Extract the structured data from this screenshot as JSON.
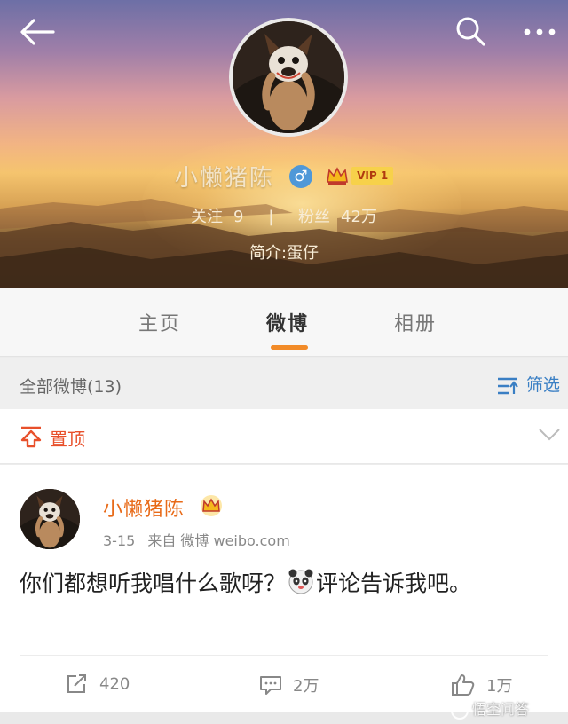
{
  "header": {
    "nickname": "小懒猪陈",
    "gender_symbol": "♂",
    "vip_label": "VIP 1",
    "following_label": "关注",
    "following_count": "9",
    "separator": "|",
    "followers_label": "粉丝",
    "followers_count": "42万",
    "bio": "简介:蛋仔",
    "icons": {
      "back": "back-arrow-icon",
      "search": "search-icon",
      "more": "more-dots-icon"
    }
  },
  "tabs": [
    {
      "label": "主页",
      "active": false
    },
    {
      "label": "微博",
      "active": true
    },
    {
      "label": "相册",
      "active": false
    }
  ],
  "filter_bar": {
    "all_posts_label": "全部微博(13)",
    "filter_label": "筛选"
  },
  "pinned": {
    "label": "置顶"
  },
  "post": {
    "author": "小懒猪陈",
    "date": "3-15",
    "source": "来自 微博 weibo.com",
    "text_before_emoji": "你们都想听我唱什么歌呀？",
    "text_after_emoji": "评论告诉我吧。",
    "emoji": "panda-emoji",
    "reposts": "420",
    "comments": "2万",
    "likes": "1万"
  },
  "watermark": "悟空问答",
  "colors": {
    "accent_orange": "#f28b28",
    "author_orange": "#e86a18",
    "pinned_red": "#e8502b",
    "filter_blue": "#3a7fc4",
    "gender_blue": "#4f98d8"
  }
}
